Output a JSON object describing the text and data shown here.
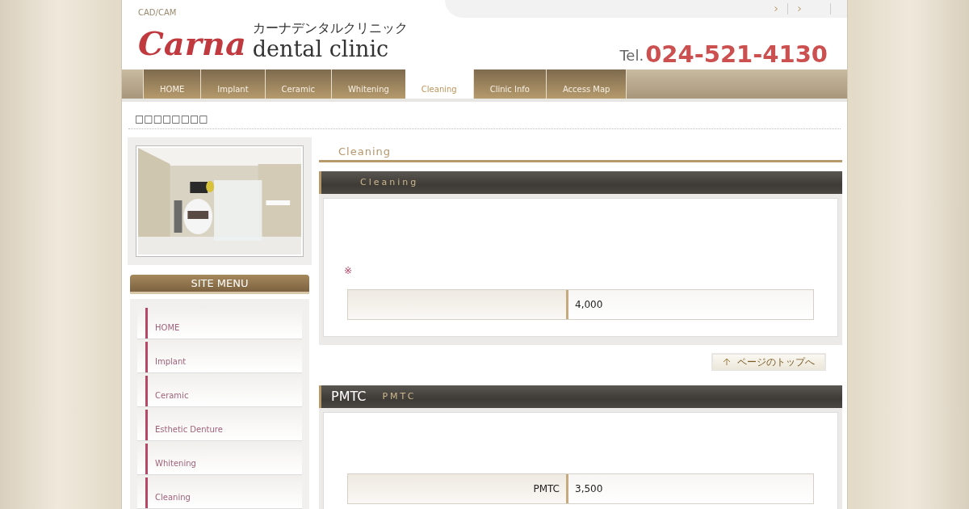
{
  "header": {
    "tagline": "CAD/CAM",
    "logo": {
      "kana": "カーナデンタルクリニック",
      "script": "Carna",
      "name": "dental clinic"
    },
    "tel_label": "Tel.",
    "tel": "024-521-4130"
  },
  "nav": [
    {
      "label": "HOME",
      "selected": false
    },
    {
      "label": "Implant",
      "selected": false
    },
    {
      "label": "Ceramic",
      "selected": false
    },
    {
      "label": "Whitening",
      "selected": false
    },
    {
      "label": "Cleaning",
      "selected": true
    },
    {
      "label": "Clinic Info",
      "selected": false
    },
    {
      "label": "Access Map",
      "selected": false
    }
  ],
  "breadcrumb": "□□□□□□□□",
  "sidebar": {
    "menu_title": "SITE MENU",
    "items": [
      "HOME",
      "Implant",
      "Ceramic",
      "Esthetic Denture",
      "Whitening",
      "Cleaning"
    ]
  },
  "page_title": "Cleaning",
  "sections": [
    {
      "subtitle": "Cleaning",
      "note": "※",
      "rows": [
        {
          "price": "4,000"
        }
      ],
      "back_to_top": "ページのトップへ"
    },
    {
      "title": "PMTC",
      "subtitle": "PMTC",
      "rows": [
        {
          "label": "PMTC",
          "price": "3,500"
        }
      ]
    }
  ]
}
